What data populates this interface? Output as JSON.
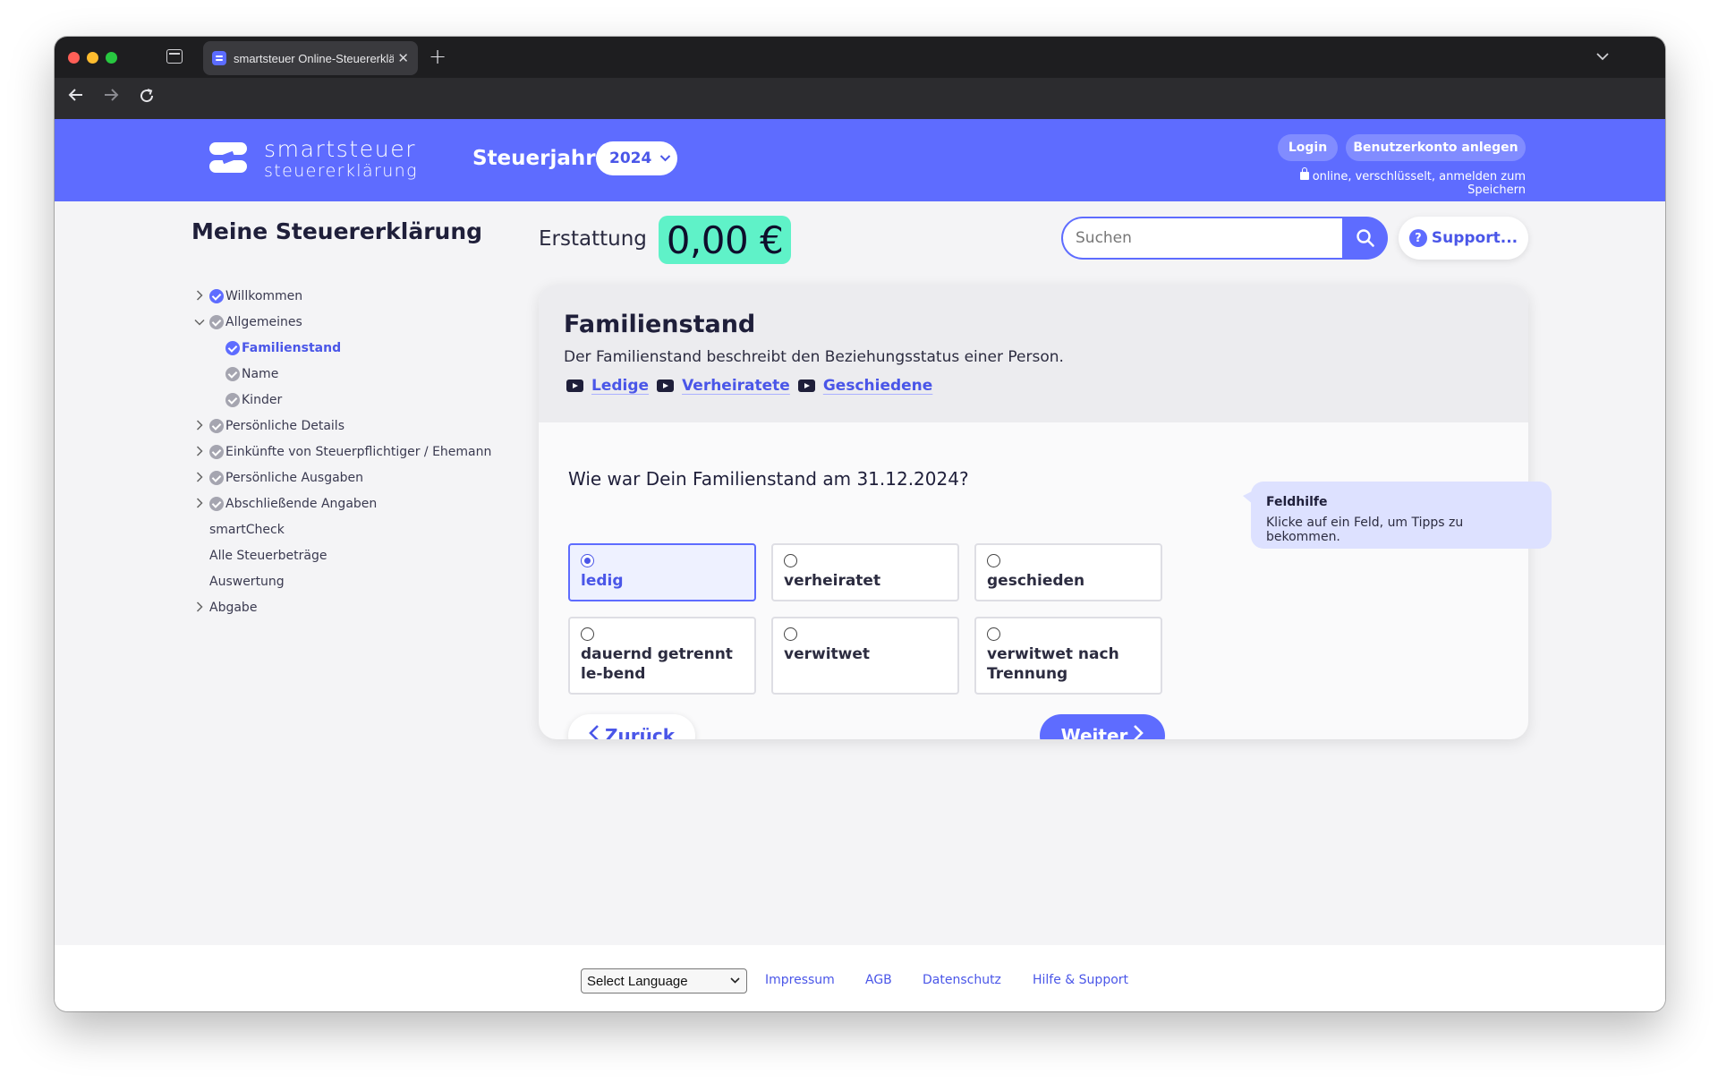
{
  "browser": {
    "tab_title": "smartsteuer Online-Steuererklä",
    "new_tab": "+",
    "close": "✕"
  },
  "header": {
    "logo_line1": "smartsteuer",
    "logo_line2": "steuererklärung",
    "tax_year_label": "Steuerjahr",
    "tax_year_value": "2024",
    "login_label": "Login",
    "register_label": "Benutzerkonto anlegen",
    "secure_note": "online, verschlüsselt, anmelden zum Speichern"
  },
  "sidebar": {
    "title": "Meine Steuererklärung",
    "items": [
      {
        "label": "Willkommen"
      },
      {
        "label": "Allgemeines"
      },
      {
        "label": "Familienstand"
      },
      {
        "label": "Name"
      },
      {
        "label": "Kinder"
      },
      {
        "label": "Persönliche Details"
      },
      {
        "label": "Einkünfte von Steuerpflichtiger / Ehemann"
      },
      {
        "label": "Persönliche Ausgaben"
      },
      {
        "label": "Abschließende Angaben"
      },
      {
        "label": "smartCheck"
      },
      {
        "label": "Alle Steuerbeträge"
      },
      {
        "label": "Auswertung"
      },
      {
        "label": "Abgabe"
      }
    ]
  },
  "main": {
    "refund_label": "Erstattung",
    "refund_value": "0,00 €",
    "search_placeholder": "Suchen",
    "support_label": "Support..."
  },
  "card": {
    "title": "Familienstand",
    "description": "Der Familienstand beschreibt den Beziehungsstatus einer Person.",
    "video_links": [
      "Ledige",
      "Verheiratete",
      "Geschiedene"
    ],
    "question": "Wie war Dein Familienstand am 31.12.2024?",
    "options": [
      {
        "label": "ledig",
        "selected": true
      },
      {
        "label": "verheiratet",
        "selected": false
      },
      {
        "label": "geschieden",
        "selected": false
      },
      {
        "label": "dauernd getrennt le-bend",
        "selected": false
      },
      {
        "label": "verwitwet",
        "selected": false
      },
      {
        "label": "verwitwet nach Trennung",
        "selected": false
      }
    ],
    "back_label": "Zurück",
    "next_label": "Weiter"
  },
  "help": {
    "title": "Feldhilfe",
    "text": "Klicke auf ein Feld, um Tipps zu bekommen."
  },
  "footer": {
    "language_select": "Select Language",
    "links": [
      "Impressum",
      "AGB",
      "Datenschutz",
      "Hilfe & Support"
    ]
  },
  "colors": {
    "brand": "#5e6cff",
    "refund": "#5ff2c8"
  }
}
